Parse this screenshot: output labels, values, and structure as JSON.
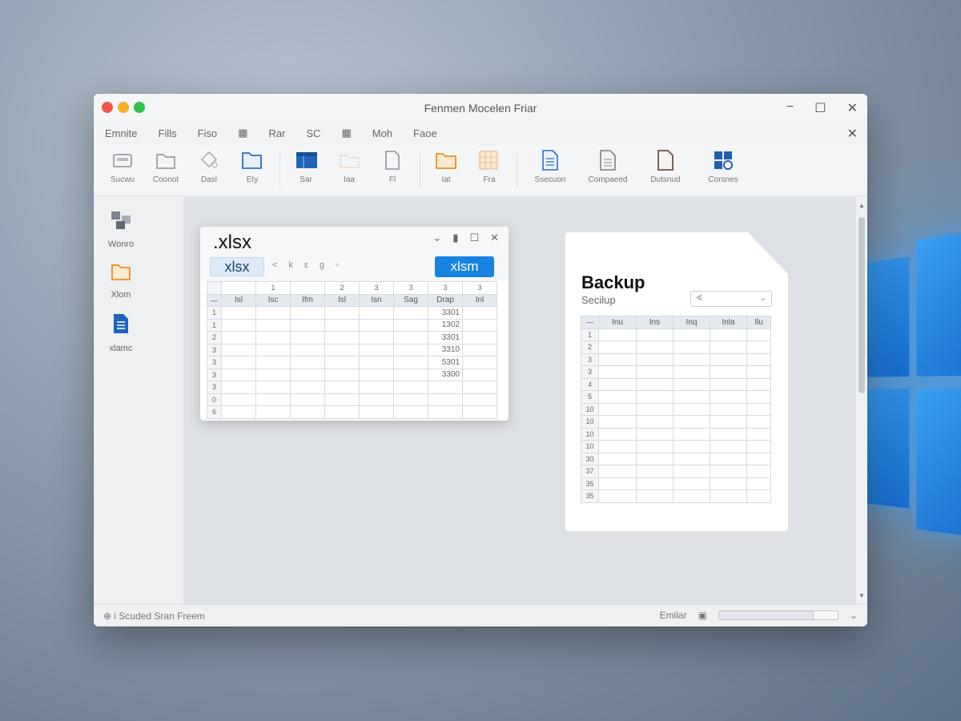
{
  "window": {
    "title": "Fenmen Mocelen Friar",
    "controls": {
      "minimize": "−",
      "maximize": "☐",
      "close": "✕"
    }
  },
  "menu": {
    "items": [
      "Emnite",
      "Fills",
      "Fiso",
      "▦",
      "Rar",
      "SC",
      "▦",
      "Moh",
      "Faoe"
    ],
    "close": "✕"
  },
  "ribbon": {
    "buttons": [
      {
        "label": "Sucwu",
        "icon": "scanner-icon"
      },
      {
        "label": "Coonot",
        "icon": "folder-outline-icon"
      },
      {
        "label": "Dasl",
        "icon": "diamond-tool-icon"
      },
      {
        "label": "Ety",
        "icon": "blue-folder-icon"
      },
      {
        "label": "Sar",
        "icon": "save-box-icon"
      },
      {
        "label": "Iaa",
        "icon": "dotted-folder-icon"
      },
      {
        "label": "Fl",
        "icon": "document-outline-icon"
      },
      {
        "label": "Iat",
        "icon": "orange-folder-icon"
      },
      {
        "label": "Fra",
        "icon": "grid-icon"
      },
      {
        "label": "Ssecuon",
        "icon": "blue-document-icon"
      },
      {
        "label": "Compaeed",
        "icon": "gray-document-icon"
      },
      {
        "label": "Dutsnud",
        "icon": "brown-document-icon"
      },
      {
        "label": "Corsnes",
        "icon": "windows-grid-icon"
      }
    ]
  },
  "sidebar": {
    "items": [
      {
        "label": "Wonro",
        "icon": "tiles-icon"
      },
      {
        "label": "Xlom",
        "icon": "orange-folder-icon"
      },
      {
        "label": "xlamc",
        "icon": "blue-document-icon"
      }
    ]
  },
  "spreadsheet": {
    "name": ".xlsx",
    "controls": [
      "⌄",
      "▮",
      "☐",
      "✕"
    ],
    "tab": "xlsx",
    "tools": [
      "<",
      "k",
      "ɛ",
      "g",
      "▫"
    ],
    "action_button": "xlsm",
    "col_numbers": [
      "",
      "1",
      "",
      "2",
      "3",
      "3",
      "3",
      "3"
    ],
    "headers": [
      "—",
      "Isl",
      "Isc",
      "Ifm",
      "Isl",
      "Isn",
      "Sag",
      "Drap",
      "Inl"
    ],
    "rows": [
      {
        "rn": "1",
        "val": "3301"
      },
      {
        "rn": "1",
        "val": "1302"
      },
      {
        "rn": "2",
        "val": "3301"
      },
      {
        "rn": "3",
        "val": "3310"
      },
      {
        "rn": "3",
        "val": "5301"
      },
      {
        "rn": "3",
        "val": "3300"
      },
      {
        "rn": "3",
        "val": ""
      },
      {
        "rn": "0",
        "val": ""
      },
      {
        "rn": "6",
        "val": ""
      }
    ]
  },
  "document": {
    "title": "Backup",
    "subtitle": "Secilup",
    "select_value": "∢",
    "select_chevron": "⌄",
    "headers": [
      "—",
      "Inu",
      "Ins",
      "Inq",
      "Inla",
      "Ilu"
    ],
    "row_numbers": [
      "1",
      "2",
      "3",
      "3",
      "4",
      "5",
      "10",
      "10",
      "10",
      "10",
      "30",
      "37",
      "35",
      "35"
    ]
  },
  "status": {
    "left": "⊕ i Scuded  Sran Freem",
    "right_label": "Emilar",
    "right_icon": "▣",
    "chevron": "⌄",
    "progress": 0.8
  },
  "scrollbar": {
    "up": "▲",
    "down": "▼"
  }
}
